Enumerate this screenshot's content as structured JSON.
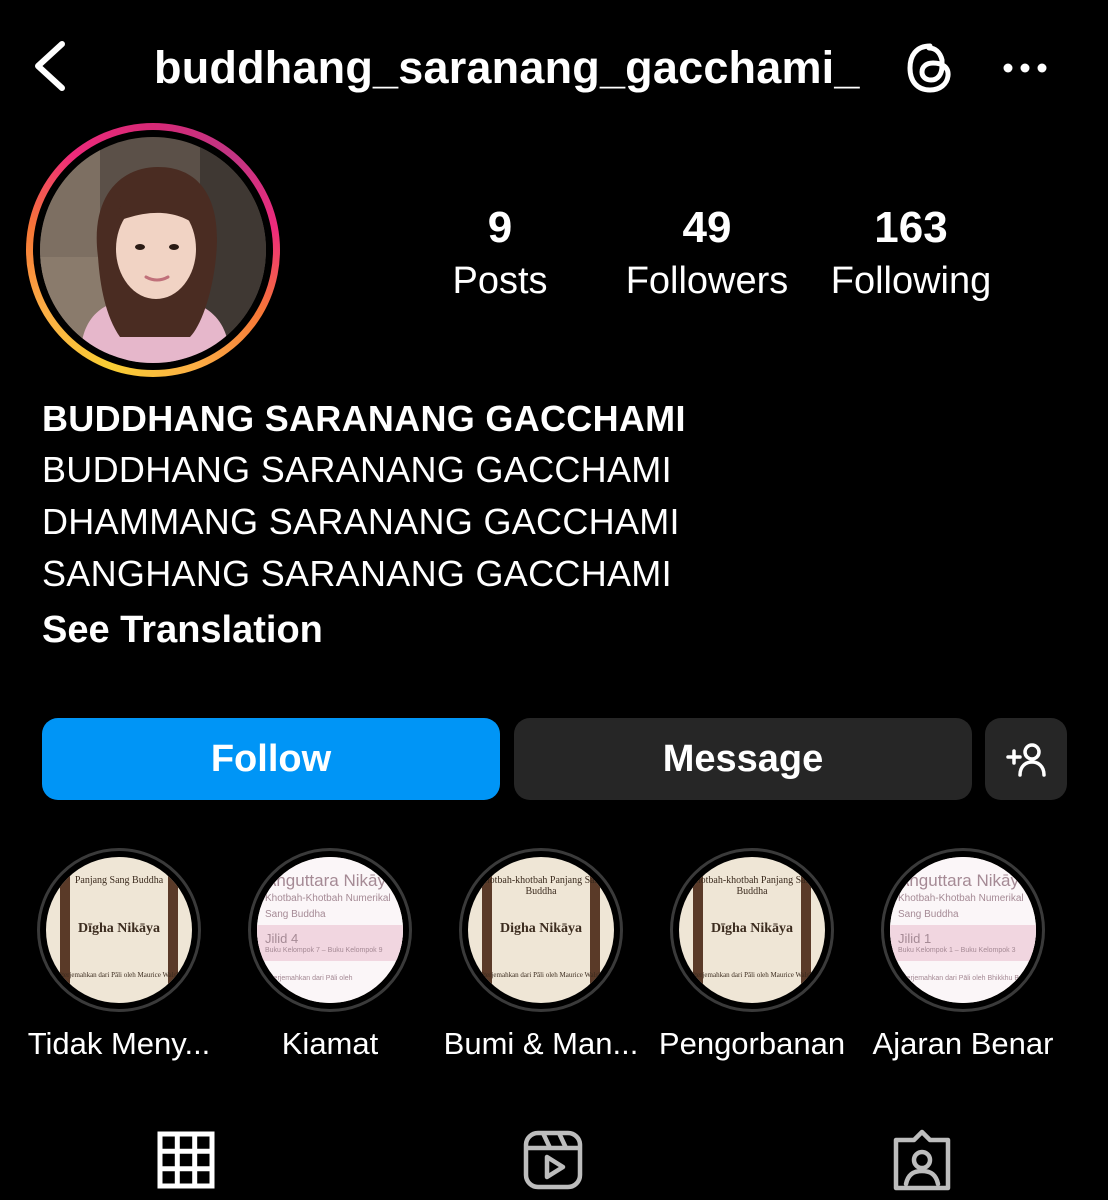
{
  "header": {
    "username": "buddhang_saranang_gacchami_",
    "back_icon": "chevron-left-icon",
    "threads_icon": "threads-icon",
    "more_icon": "more-horizontal-icon"
  },
  "stats": {
    "posts": {
      "value": "9",
      "label": "Posts"
    },
    "followers": {
      "value": "49",
      "label": "Followers"
    },
    "following": {
      "value": "163",
      "label": "Following"
    }
  },
  "bio": {
    "name": "BUDDHANG SARANANG GACCHAMI",
    "lines": [
      "BUDDHANG SARANANG GACCHAMI",
      "DHAMMANG SARANANG GACCHAMI",
      "SANGHANG SARANANG GACCHAMI"
    ],
    "see_translation": "See Translation"
  },
  "actions": {
    "follow": "Follow",
    "message": "Message",
    "add_user_icon": "add-user-icon"
  },
  "highlights": [
    {
      "label": "Tidak Meny...",
      "cover": {
        "top": "Panjang Sang Buddha",
        "title": "Dīgha Nikāya",
        "bottom": "Diterjemahkan dari Pāli oleh Maurice Walshe"
      }
    },
    {
      "label": "Kiamat",
      "cover": {
        "title": "Anguttara Nikāya",
        "sub": "Khotbah-Khotbah Numerikal",
        "sub2": "Sang Buddha",
        "vol": "Jilid 4",
        "vol_sub": "Buku Kelompok 7 – Buku Kelompok 9",
        "bottom": "Diterjemahkan dari Pāli oleh"
      }
    },
    {
      "label": "Bumi & Man...",
      "cover": {
        "top": "Khotbah-khotbah Panjang Sang Buddha",
        "title": "Digha Nikāya",
        "bottom": "Diterjemahkan dari Pāli oleh Maurice Walshe"
      }
    },
    {
      "label": "Pengorbanan",
      "cover": {
        "top": "Khotbah-khotbah Panjang Sang Buddha",
        "title": "Dīgha Nikāya",
        "bottom": "Diterjemahkan dari Pāli oleh Maurice Walshe"
      }
    },
    {
      "label": "Ajaran Benar",
      "cover": {
        "title": "Anguttara Nikāya",
        "sub": "Khotbah-Khotbah Numerikal",
        "sub2": "Sang Buddha",
        "vol": "Jilid 1",
        "vol_sub": "Buku Kelompok 1 – Buku Kelompok 3",
        "bottom": "Diterjemahkan dari Pāli oleh Bhikkhu Bodhi"
      }
    }
  ],
  "tabs": [
    {
      "icon": "grid-icon",
      "active": true
    },
    {
      "icon": "reels-icon",
      "active": false
    },
    {
      "icon": "tagged-icon",
      "active": false
    }
  ],
  "colors": {
    "background": "#000000",
    "follow_button": "#0095f6",
    "secondary_button": "#262626",
    "text": "#ffffff"
  }
}
